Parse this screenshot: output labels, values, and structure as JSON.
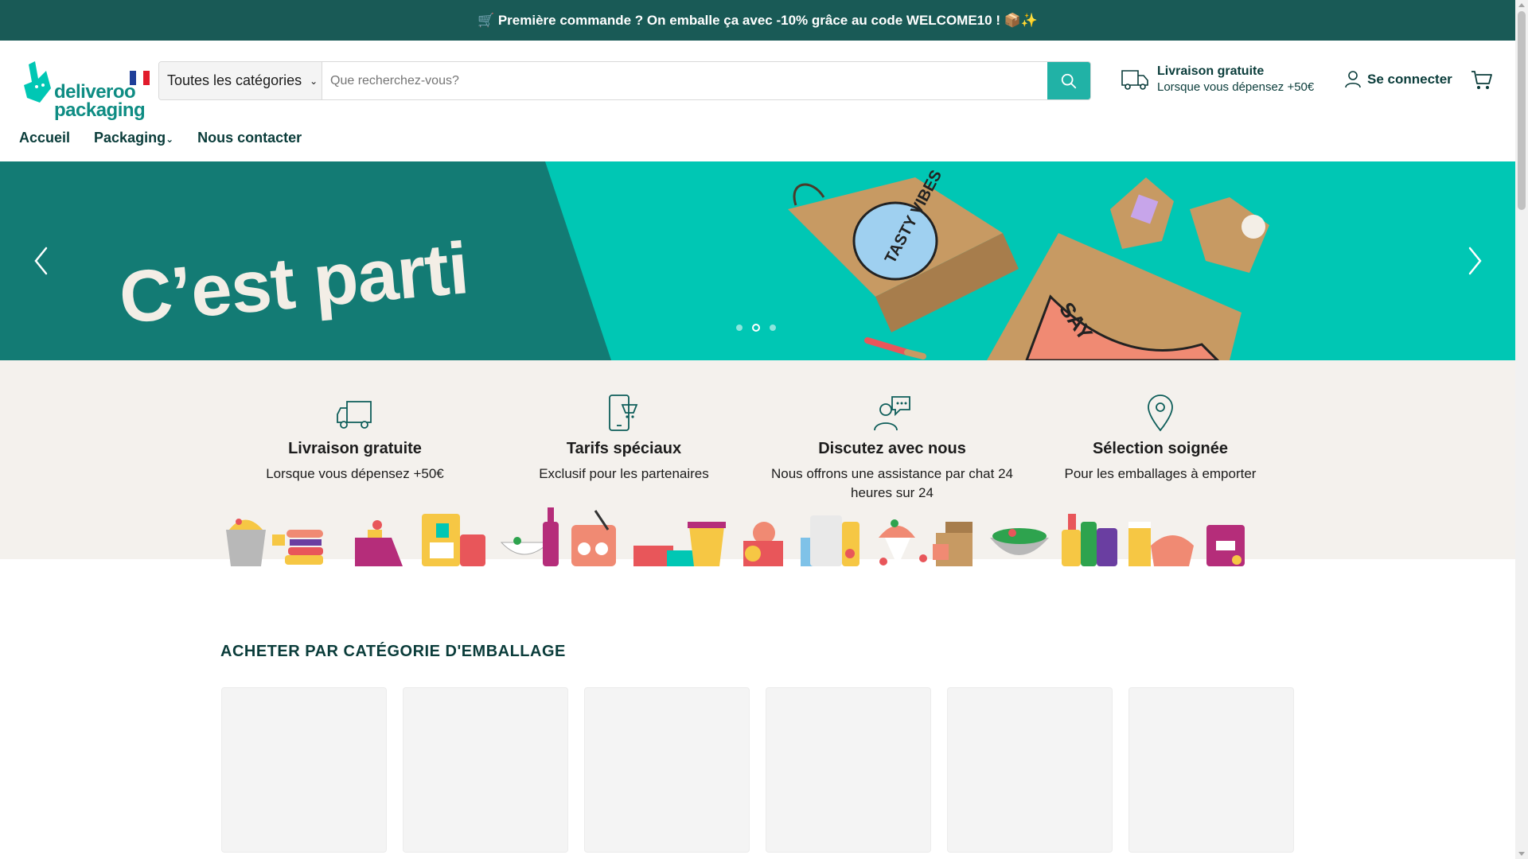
{
  "announcement": "🛒 Première commande ? On emballe ça avec -10% grâce au code WELCOME10 ! 📦✨",
  "logo": {
    "line1": "deliveroo",
    "line2": "packaging",
    "flag": "fr-flag"
  },
  "search": {
    "category": "Toutes les catégories",
    "placeholder": "Que recherchez-vous?"
  },
  "shipping": {
    "title": "Livraison gratuite",
    "subtitle": "Lorsque vous dépensez +50€"
  },
  "account": {
    "login": "Se connecter"
  },
  "nav": {
    "home": "Accueil",
    "packaging": "Packaging",
    "contact": "Nous contacter"
  },
  "hero": {
    "title": "C’est parti",
    "slides": 3,
    "active_slide": 2
  },
  "features": [
    {
      "icon": "truck-icon",
      "title": "Livraison gratuite",
      "desc": "Lorsque vous dépensez +50€"
    },
    {
      "icon": "phone-icon",
      "title": "Tarifs spéciaux",
      "desc": "Exclusif pour les partenaires"
    },
    {
      "icon": "chat-support-icon",
      "title": "Discutez avec nous",
      "desc": "Nous offrons une assistance par chat 24 heures sur 24"
    },
    {
      "icon": "location-pin-icon",
      "title": "Sélection soignée",
      "desc": "Pour les emballages à emporter"
    }
  ],
  "section": {
    "title": "ACHETER PAR CATÉGORIE D'EMBALLAGE"
  },
  "colors": {
    "announcement_bg": "#195a56",
    "accent": "#21b2a6",
    "hero": "#00c7b4",
    "hero_dark": "#137b74",
    "text": "#0a3c3a",
    "features_bg": "#f4f1ed"
  }
}
